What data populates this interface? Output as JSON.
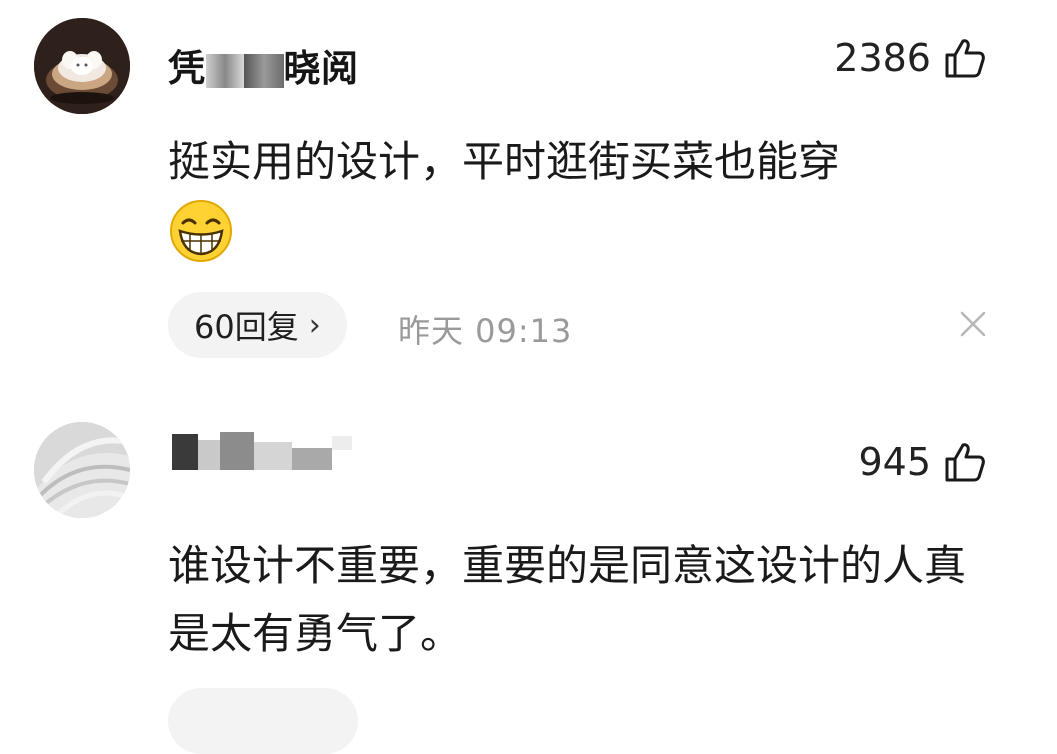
{
  "comments": [
    {
      "username_visible_start": "凭",
      "username_visible_end": "晓阅",
      "likes": "2386",
      "text": "挺实用的设计，平时逛街买菜也能穿",
      "emoji": "grinning-face",
      "replies_label": "60回复",
      "time": "昨天  09:13"
    },
    {
      "username": "",
      "likes": "945",
      "text": "谁设计不重要，重要的是同意这设计的人真是太有勇气了。"
    }
  ],
  "colors": {
    "text": "#1a1a1a",
    "muted": "#9a9a9a",
    "pill_bg": "#f3f3f3"
  }
}
